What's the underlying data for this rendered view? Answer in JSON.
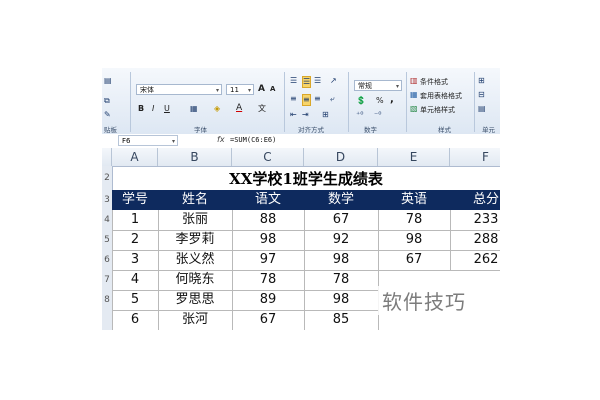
{
  "ribbon": {
    "font_name": "宋体",
    "font_size": "11",
    "grow_icon": "A",
    "shrink_icon": "A",
    "bold": "B",
    "italic": "I",
    "underline": "U",
    "number_format": "常规",
    "percent": "%",
    "comma": ",",
    "wen_button": "文",
    "cond_format": "条件格式",
    "table_format": "套用表格格式",
    "cell_style": "单元格样式",
    "groups": {
      "clipboard": "贴板",
      "font": "字体",
      "alignment": "对齐方式",
      "number": "数字",
      "style": "样式",
      "cells": "单元"
    }
  },
  "formula_bar": {
    "name_box": "F6",
    "fx": "fx",
    "formula": "=SUM(C6:E6)"
  },
  "columns": [
    "A",
    "B",
    "C",
    "D",
    "E",
    "F"
  ],
  "row_numbers": [
    "2",
    "3",
    "4",
    "5",
    "6",
    "7",
    "8"
  ],
  "table": {
    "title": "XX学校1班学生成绩表",
    "headers": [
      "学号",
      "姓名",
      "语文",
      "数学",
      "英语",
      "总分"
    ],
    "rows": [
      [
        "1",
        "张丽",
        "88",
        "67",
        "78",
        "233"
      ],
      [
        "2",
        "李罗莉",
        "98",
        "92",
        "98",
        "288"
      ],
      [
        "3",
        "张义然",
        "97",
        "98",
        "67",
        "262"
      ],
      [
        "4",
        "何晓东",
        "78",
        "78",
        "",
        ""
      ],
      [
        "5",
        "罗思思",
        "89",
        "98",
        "",
        ""
      ],
      [
        "6",
        "张河",
        "67",
        "85",
        "",
        ""
      ]
    ]
  },
  "watermark": "软件技巧",
  "colors": {
    "header_fill": "#0e2a5e",
    "header_text": "#ffffff",
    "ribbon_bg": "#dde7f3"
  }
}
